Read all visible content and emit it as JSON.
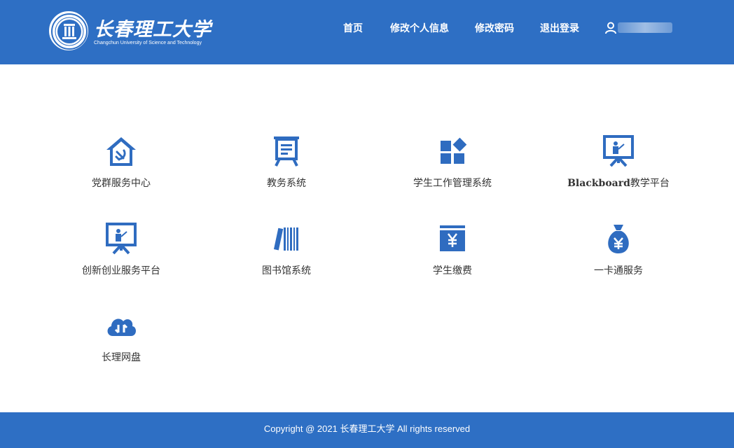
{
  "brand": {
    "name_cn": "长春理工大学",
    "name_en": "Changchun University of Science and Technology"
  },
  "nav": {
    "home": "首页",
    "edit_profile": "修改个人信息",
    "change_password": "修改密码",
    "logout": "退出登录"
  },
  "apps": [
    {
      "label": "党群服务中心",
      "icon": "party-house-icon"
    },
    {
      "label": "教务系统",
      "icon": "presentation-board-icon"
    },
    {
      "label": "学生工作管理系统",
      "icon": "grid-blocks-icon"
    },
    {
      "label": "Blackboard教学平台",
      "icon": "teacher-screen-icon",
      "label_latin": "Blackboard",
      "label_cn": "教学平台"
    },
    {
      "label": "创新创业服务平台",
      "icon": "teacher-screen-icon"
    },
    {
      "label": "图书馆系统",
      "icon": "books-icon"
    },
    {
      "label": "学生缴费",
      "icon": "yuan-wallet-icon"
    },
    {
      "label": "一卡通服务",
      "icon": "money-bag-icon"
    },
    {
      "label": "长理网盘",
      "icon": "cloud-transfer-icon"
    }
  ],
  "footer": {
    "copyright": "Copyright @ 2021 长春理工大学 All rights reserved"
  },
  "colors": {
    "brand_blue": "#2e6fc4",
    "icon_blue": "#2f6cc0"
  }
}
